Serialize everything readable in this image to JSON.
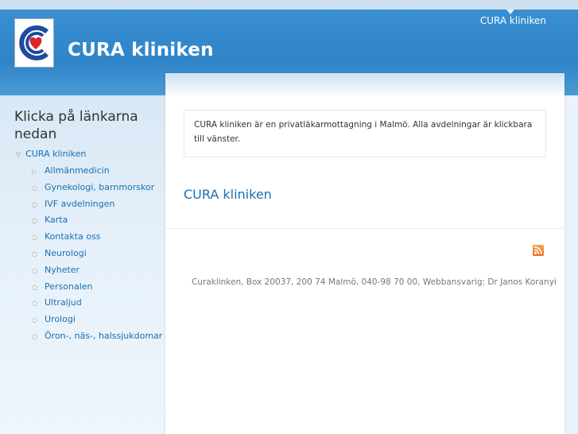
{
  "header": {
    "site_name": "CURA kliniken",
    "top_nav_link": "CURA kliniken"
  },
  "sidebar": {
    "title": "Klicka på länkarna nedan",
    "root_item": "CURA kliniken",
    "items": [
      "Allmänmedicin",
      "Gynekologi, barnmorskor",
      "IVF avdelningen",
      "Karta",
      "Kontakta oss",
      "Neurologi",
      "Nyheter",
      "Personalen",
      "Ultraljud",
      "Urologi",
      "Öron-, näs-, halssjukdomar"
    ]
  },
  "main": {
    "intro": "CURA kliniken är en privatläkarmottagning i Malmö. Alla avdelningar är klickbara till vänster.",
    "heading": "CURA kliniken",
    "footer": "Curaklinken, Box 20037, 200 74 Malmö, 040-98 70 00, Webbansvarig: Dr Janos Koranyi"
  },
  "icons": {
    "logo": "cura-heart-logo-icon",
    "rss": "rss-feed-icon"
  },
  "colors": {
    "header_blue": "#2f84c8",
    "link_blue": "#1a6fb3",
    "logo_red": "#e0202a",
    "logo_blue": "#1e4aa0",
    "rss_orange": "#e8731a"
  }
}
